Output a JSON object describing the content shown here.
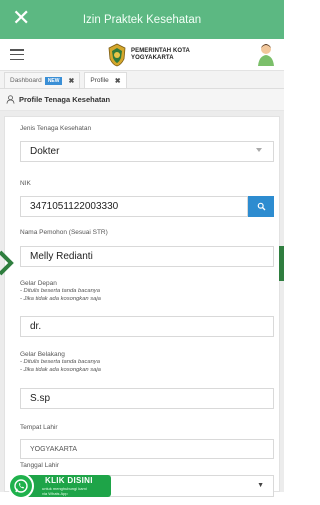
{
  "topbar": {
    "title": "Izin Praktek Kesehatan",
    "close_icon": "close-icon"
  },
  "header": {
    "logo_line1": "PEMERINTAH KOTA",
    "logo_line2": "YOGYAKARTA"
  },
  "tabs": [
    {
      "label": "Dashboard",
      "badge": "NEW",
      "close": "✖"
    },
    {
      "label": "Profile",
      "close": "✖"
    }
  ],
  "section": {
    "title": "Profile Tenaga Kesehatan"
  },
  "form": {
    "jenis": {
      "label": "Jenis Tenaga Kesehatan",
      "value": "Dokter"
    },
    "nik": {
      "label": "NIK",
      "value": "3471051122003330"
    },
    "nama": {
      "label": "Nama Pemohon (Sesuai STR)",
      "value": "Melly Redianti"
    },
    "gelar_depan": {
      "label": "Gelar Depan",
      "hint1": "- Ditulis beserta tanda bacanya",
      "hint2": "- Jika tidak ada kosongkan saja",
      "value": "dr."
    },
    "gelar_belakang": {
      "label": "Gelar Belakang",
      "hint1": "- Ditulis beserta tanda bacanya",
      "hint2": "- Jika tidak ada kosongkan saja",
      "value": "S.sp"
    },
    "tempat_lahir": {
      "label": "Tempat Lahir",
      "value": "YOGYAKARTA"
    },
    "tanggal_lahir": {
      "label": "Tanggal Lahir"
    }
  },
  "whatsapp": {
    "title": "KLIK DISINI",
    "sub1": "untuk menghubungi kami",
    "sub2": "via Whats App"
  },
  "colors": {
    "topbar": "#5cb882",
    "accent": "#2d8cd0",
    "whatsapp": "#1ea448"
  }
}
